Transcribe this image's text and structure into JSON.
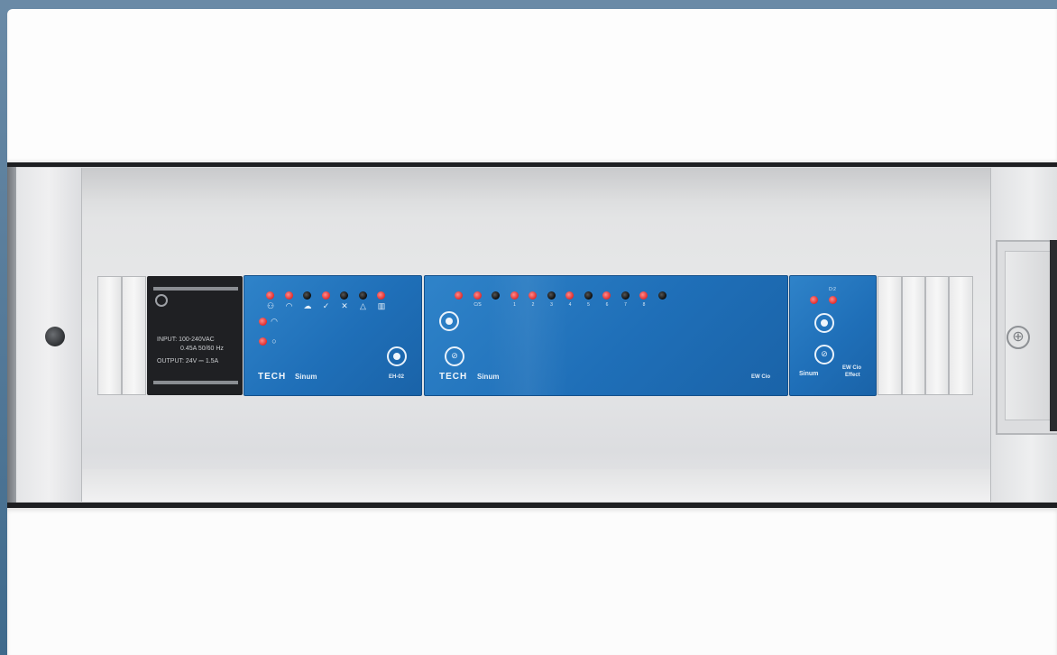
{
  "psu": {
    "line1": "INPUT: 100-240VAC",
    "line2": "0.45A  50/60 Hz",
    "line3": "OUTPUT: 24V ⎓ 1.5A"
  },
  "module1": {
    "brand": "TECH",
    "product": "Sinum",
    "model": "EH-02",
    "leds": [
      "red",
      "red",
      "black",
      "red",
      "black",
      "black",
      "red"
    ],
    "icons": [
      "network-icon",
      "wifi-icon",
      "cloud-icon",
      "check-icon",
      "cross-icon",
      "warning-icon",
      "battery-icon"
    ]
  },
  "module2": {
    "brand": "TECH",
    "product": "Sinum",
    "model": "EW Cio",
    "leds": [
      "red",
      "red",
      "black",
      "red",
      "red",
      "black",
      "red",
      "black",
      "red",
      "black",
      "red",
      "black"
    ],
    "labels": [
      "",
      "C/S",
      "",
      "1",
      "2",
      "3",
      "4",
      "5",
      "6",
      "7",
      "8"
    ]
  },
  "module3": {
    "product": "Sinum",
    "model_line1": "EW Cio",
    "model_line2": "Effect",
    "labels": [
      "",
      "D:2"
    ]
  },
  "colors": {
    "module_blue": "#1f6fb8",
    "led_red": "#e02b2b",
    "enclosure": "#e6e7e8"
  }
}
